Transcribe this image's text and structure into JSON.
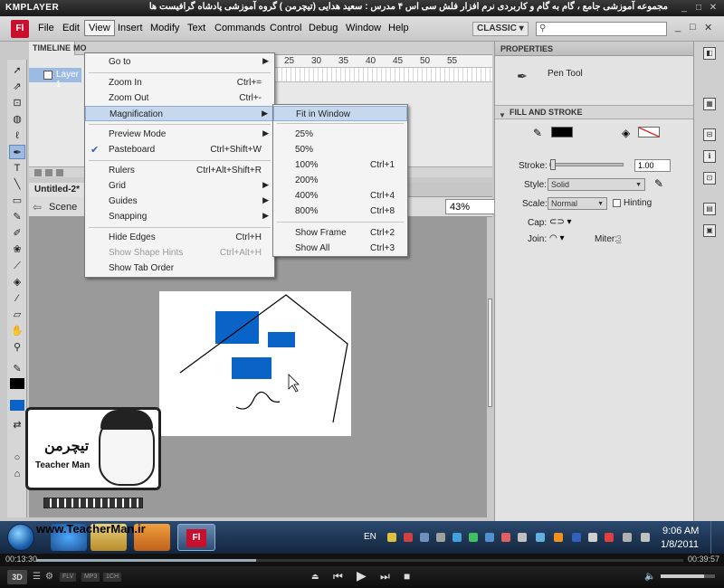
{
  "kmplayer": {
    "logo": "KMPLAYER",
    "video_title": "مجموعه آموزشی جامع ، گام به گام و کاربردی نرم افزار فلش سی اس ۴ مدرس : سعید هدایی (تیچرمن ) گروه آموزشی پادشاه گرافیست ها",
    "time_start": "00:13:30",
    "time_end": "00:39:57",
    "progress_fraction": 0.34,
    "volume_fraction": 0.8,
    "badge_3d": "3D",
    "tags": [
      "FLV",
      "MP3",
      "1CH"
    ]
  },
  "flash": {
    "logo": "Fl",
    "menu": [
      "File",
      "Edit",
      "View",
      "Insert",
      "Modify",
      "Text",
      "Commands",
      "Control",
      "Debug",
      "Window",
      "Help"
    ],
    "workspace": "CLASSIC ▾",
    "window_controls": [
      "_",
      "□",
      "✕"
    ],
    "timeline": {
      "tab_timeline": "TIMELINE",
      "tab_motion": "MO",
      "layer_name": "Layer 1",
      "frame_numbers": [
        "25",
        "30",
        "35",
        "40",
        "45",
        "50",
        "55"
      ]
    },
    "document": {
      "tab": "Untitled-2*",
      "scene": "Scene",
      "zoom": "43%"
    },
    "properties": {
      "title": "PROPERTIES",
      "tool_name": "Pen Tool",
      "section_fill_stroke": "FILL AND STROKE",
      "stroke_label": "Stroke:",
      "stroke_value": "1.00",
      "style_label": "Style:",
      "style_value": "Solid",
      "scale_label": "Scale:",
      "scale_value": "Normal",
      "hinting_label": "Hinting",
      "cap_label": "Cap:",
      "join_label": "Join:",
      "miter_label": "Miter:",
      "miter_value": "3"
    },
    "view_menu": {
      "goto": "Go to",
      "zoom_in": "Zoom In",
      "zoom_in_sc": "Ctrl+=",
      "zoom_out": "Zoom Out",
      "zoom_out_sc": "Ctrl+-",
      "magnification": "Magnification",
      "preview_mode": "Preview Mode",
      "pasteboard": "Pasteboard",
      "pasteboard_sc": "Ctrl+Shift+W",
      "rulers": "Rulers",
      "rulers_sc": "Ctrl+Alt+Shift+R",
      "grid": "Grid",
      "guides": "Guides",
      "snapping": "Snapping",
      "hide_edges": "Hide Edges",
      "hide_edges_sc": "Ctrl+H",
      "show_shape_hints": "Show Shape Hints",
      "show_shape_hints_sc": "Ctrl+Alt+H",
      "show_tab_order": "Show Tab Order"
    },
    "magnification_menu": {
      "fit_in_window": "Fit in Window",
      "p25": "25%",
      "p50": "50%",
      "p100": "100%",
      "p100_sc": "Ctrl+1",
      "p200": "200%",
      "p400": "400%",
      "p400_sc": "Ctrl+4",
      "p800": "800%",
      "p800_sc": "Ctrl+8",
      "show_frame": "Show Frame",
      "show_frame_sc": "Ctrl+2",
      "show_all": "Show All",
      "show_all_sc": "Ctrl+3"
    }
  },
  "watermark": {
    "brand": "Teacher Man",
    "farsi": "تیچرمن",
    "site": "www.TeacherMan.ir"
  },
  "taskbar": {
    "language": "EN",
    "time": "9:06 AM",
    "date": "1/8/2011"
  },
  "colors": {
    "shape_fill": "#0a64c8",
    "flash_red": "#c8102e",
    "highlight": "#c6d8ee"
  }
}
